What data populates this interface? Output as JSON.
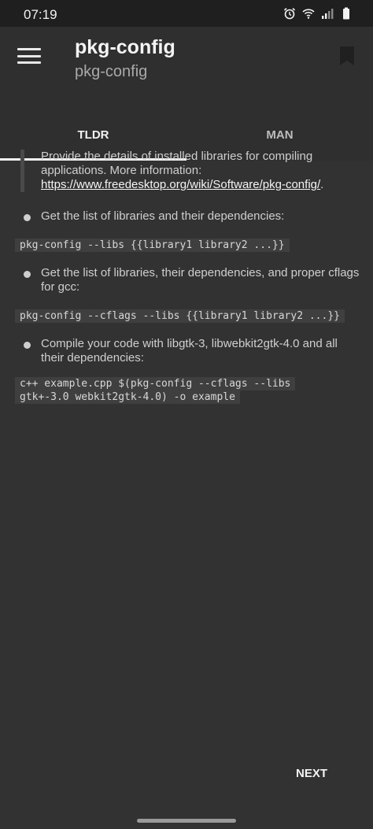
{
  "status_bar": {
    "time": "07:19",
    "icons": [
      "alarm-icon",
      "wifi-icon",
      "signal-icon",
      "battery-icon"
    ]
  },
  "header": {
    "title": "pkg-config",
    "subtitle": "pkg-config"
  },
  "tabs": [
    {
      "label": "TLDR",
      "active": true
    },
    {
      "label": "MAN",
      "active": false
    }
  ],
  "description": {
    "text": "Provide the details of installed libraries for compiling applications. More information: ",
    "link": "https://www.freedesktop.org/wiki/Software/pkg-config/",
    "suffix": "."
  },
  "examples": [
    {
      "description": "Get the list of libraries and their dependencies:",
      "command": "pkg-config --libs {{library1 library2 ...}}"
    },
    {
      "description": "Get the list of libraries, their dependencies, and proper cflags for gcc:",
      "command": "pkg-config --cflags --libs {{library1 library2 ...}}"
    },
    {
      "description": "Compile your code with libgtk-3, libwebkit2gtk-4.0 and all their dependencies:",
      "command": "c++ example.cpp $(pkg-config --cflags --libs gtk+-3.0 webkit2gtk-4.0) -o example"
    }
  ],
  "footer": {
    "next_label": "NEXT"
  },
  "colors": {
    "background": "#323232",
    "status_bar": "#1f1f1f",
    "code_background": "#3f3f3f",
    "text": "#cfcfcf"
  }
}
